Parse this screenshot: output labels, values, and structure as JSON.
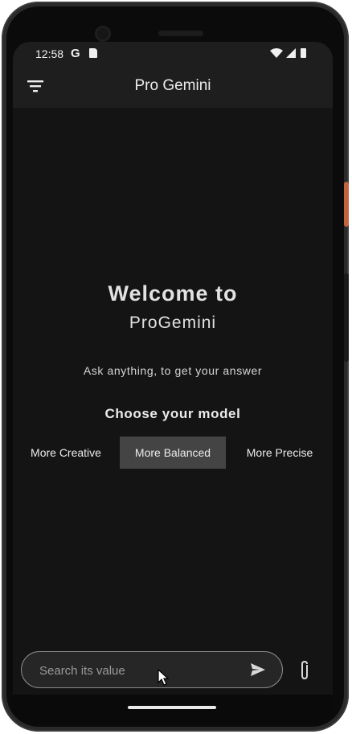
{
  "status_bar": {
    "time": "12:58",
    "g_label": "G",
    "icons": [
      "sd-card-icon",
      "wifi-icon",
      "signal-icon",
      "battery-icon"
    ]
  },
  "app_bar": {
    "title": "Pro Gemini",
    "menu_icon": "filter-icon"
  },
  "welcome": {
    "line1": "Welcome to",
    "line2": "ProGemini",
    "subtitle": "Ask anything, to get your answer"
  },
  "model_selector": {
    "heading": "Choose your model",
    "options": [
      "More Creative",
      "More Balanced",
      "More Precise"
    ],
    "selected": "More Balanced"
  },
  "input": {
    "placeholder": "Search its value",
    "value": ""
  },
  "colors": {
    "background": "#141414",
    "app_bar": "#1e1e1e",
    "selected_option": "#444444",
    "text": "#e2e2e2"
  }
}
